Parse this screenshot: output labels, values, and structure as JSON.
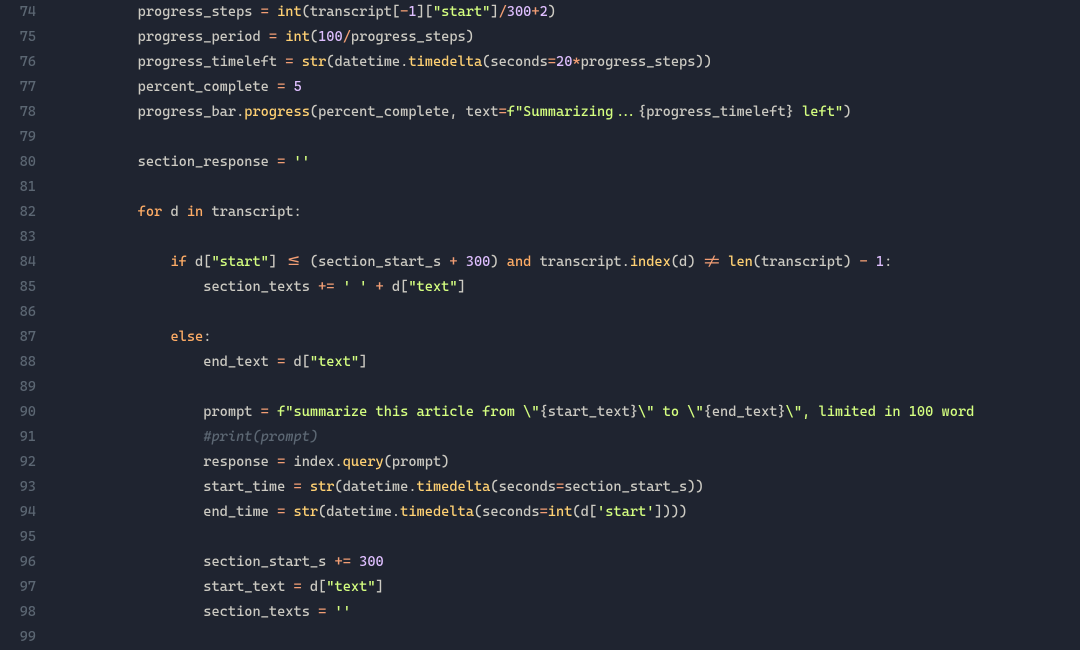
{
  "editor": {
    "first_line_number": 74,
    "lines": [
      {
        "n": 74,
        "tokens": [
          {
            "t": "indent",
            "v": "        "
          },
          {
            "t": "default",
            "v": "progress_steps "
          },
          {
            "t": "operator",
            "v": "="
          },
          {
            "t": "default",
            "v": " "
          },
          {
            "t": "builtin",
            "v": "int"
          },
          {
            "t": "punct",
            "v": "("
          },
          {
            "t": "default",
            "v": "transcript"
          },
          {
            "t": "punct",
            "v": "["
          },
          {
            "t": "operator",
            "v": "-"
          },
          {
            "t": "number",
            "v": "1"
          },
          {
            "t": "punct",
            "v": "]["
          },
          {
            "t": "string",
            "v": "\"start\""
          },
          {
            "t": "punct",
            "v": "]"
          },
          {
            "t": "operator",
            "v": "/"
          },
          {
            "t": "number",
            "v": "300"
          },
          {
            "t": "operator",
            "v": "+"
          },
          {
            "t": "number",
            "v": "2"
          },
          {
            "t": "punct",
            "v": ")"
          }
        ]
      },
      {
        "n": 75,
        "tokens": [
          {
            "t": "indent",
            "v": "        "
          },
          {
            "t": "default",
            "v": "progress_period "
          },
          {
            "t": "operator",
            "v": "="
          },
          {
            "t": "default",
            "v": " "
          },
          {
            "t": "builtin",
            "v": "int"
          },
          {
            "t": "punct",
            "v": "("
          },
          {
            "t": "number",
            "v": "100"
          },
          {
            "t": "operator",
            "v": "/"
          },
          {
            "t": "default",
            "v": "progress_steps"
          },
          {
            "t": "punct",
            "v": ")"
          }
        ]
      },
      {
        "n": 76,
        "tokens": [
          {
            "t": "indent",
            "v": "        "
          },
          {
            "t": "default",
            "v": "progress_timeleft "
          },
          {
            "t": "operator",
            "v": "="
          },
          {
            "t": "default",
            "v": " "
          },
          {
            "t": "builtin",
            "v": "str"
          },
          {
            "t": "punct",
            "v": "("
          },
          {
            "t": "default",
            "v": "datetime"
          },
          {
            "t": "punct",
            "v": "."
          },
          {
            "t": "function",
            "v": "timedelta"
          },
          {
            "t": "punct",
            "v": "("
          },
          {
            "t": "default",
            "v": "seconds"
          },
          {
            "t": "operator",
            "v": "="
          },
          {
            "t": "number",
            "v": "20"
          },
          {
            "t": "operator",
            "v": "*"
          },
          {
            "t": "default",
            "v": "progress_steps"
          },
          {
            "t": "punct",
            "v": "))"
          }
        ]
      },
      {
        "n": 77,
        "tokens": [
          {
            "t": "indent",
            "v": "        "
          },
          {
            "t": "default",
            "v": "percent_complete "
          },
          {
            "t": "operator",
            "v": "="
          },
          {
            "t": "default",
            "v": " "
          },
          {
            "t": "number",
            "v": "5"
          }
        ]
      },
      {
        "n": 78,
        "tokens": [
          {
            "t": "indent",
            "v": "        "
          },
          {
            "t": "default",
            "v": "progress_bar"
          },
          {
            "t": "punct",
            "v": "."
          },
          {
            "t": "function",
            "v": "progress"
          },
          {
            "t": "punct",
            "v": "("
          },
          {
            "t": "default",
            "v": "percent_complete"
          },
          {
            "t": "punct",
            "v": ", "
          },
          {
            "t": "default",
            "v": "text"
          },
          {
            "t": "operator",
            "v": "="
          },
          {
            "t": "fstring-prefix",
            "v": "f"
          },
          {
            "t": "string",
            "v": "\"Summarizing..."
          },
          {
            "t": "punct",
            "v": "{"
          },
          {
            "t": "default",
            "v": "progress_timeleft"
          },
          {
            "t": "punct",
            "v": "}"
          },
          {
            "t": "string",
            "v": " left\""
          },
          {
            "t": "punct",
            "v": ")"
          }
        ]
      },
      {
        "n": 79,
        "tokens": []
      },
      {
        "n": 80,
        "tokens": [
          {
            "t": "indent",
            "v": "        "
          },
          {
            "t": "default",
            "v": "section_response "
          },
          {
            "t": "operator",
            "v": "="
          },
          {
            "t": "default",
            "v": " "
          },
          {
            "t": "string",
            "v": "''"
          }
        ]
      },
      {
        "n": 81,
        "tokens": []
      },
      {
        "n": 82,
        "tokens": [
          {
            "t": "indent",
            "v": "        "
          },
          {
            "t": "keyword",
            "v": "for"
          },
          {
            "t": "default",
            "v": " d "
          },
          {
            "t": "keyword",
            "v": "in"
          },
          {
            "t": "default",
            "v": " transcript"
          },
          {
            "t": "punct",
            "v": ":"
          }
        ]
      },
      {
        "n": 83,
        "tokens": []
      },
      {
        "n": 84,
        "tokens": [
          {
            "t": "indent",
            "v": "            "
          },
          {
            "t": "keyword",
            "v": "if"
          },
          {
            "t": "default",
            "v": " d"
          },
          {
            "t": "punct",
            "v": "["
          },
          {
            "t": "string",
            "v": "\"start\""
          },
          {
            "t": "punct",
            "v": "] "
          },
          {
            "t": "operator",
            "v": "<="
          },
          {
            "t": "default",
            "v": " "
          },
          {
            "t": "punct",
            "v": "("
          },
          {
            "t": "default",
            "v": "section_start_s "
          },
          {
            "t": "operator",
            "v": "+"
          },
          {
            "t": "default",
            "v": " "
          },
          {
            "t": "number",
            "v": "300"
          },
          {
            "t": "punct",
            "v": ")"
          },
          {
            "t": "default",
            "v": " "
          },
          {
            "t": "keyword",
            "v": "and"
          },
          {
            "t": "default",
            "v": " transcript"
          },
          {
            "t": "punct",
            "v": "."
          },
          {
            "t": "function",
            "v": "index"
          },
          {
            "t": "punct",
            "v": "("
          },
          {
            "t": "default",
            "v": "d"
          },
          {
            "t": "punct",
            "v": ") "
          },
          {
            "t": "operator",
            "v": "!="
          },
          {
            "t": "default",
            "v": " "
          },
          {
            "t": "builtin",
            "v": "len"
          },
          {
            "t": "punct",
            "v": "("
          },
          {
            "t": "default",
            "v": "transcript"
          },
          {
            "t": "punct",
            "v": ") "
          },
          {
            "t": "operator",
            "v": "-"
          },
          {
            "t": "default",
            "v": " "
          },
          {
            "t": "number",
            "v": "1"
          },
          {
            "t": "punct",
            "v": ":"
          }
        ]
      },
      {
        "n": 85,
        "tokens": [
          {
            "t": "indent",
            "v": "                "
          },
          {
            "t": "default",
            "v": "section_texts "
          },
          {
            "t": "operator",
            "v": "+="
          },
          {
            "t": "default",
            "v": " "
          },
          {
            "t": "string",
            "v": "' '"
          },
          {
            "t": "default",
            "v": " "
          },
          {
            "t": "operator",
            "v": "+"
          },
          {
            "t": "default",
            "v": " d"
          },
          {
            "t": "punct",
            "v": "["
          },
          {
            "t": "string",
            "v": "\"text\""
          },
          {
            "t": "punct",
            "v": "]"
          }
        ]
      },
      {
        "n": 86,
        "tokens": []
      },
      {
        "n": 87,
        "tokens": [
          {
            "t": "indent",
            "v": "            "
          },
          {
            "t": "keyword",
            "v": "else"
          },
          {
            "t": "punct",
            "v": ":"
          }
        ]
      },
      {
        "n": 88,
        "tokens": [
          {
            "t": "indent",
            "v": "                "
          },
          {
            "t": "default",
            "v": "end_text "
          },
          {
            "t": "operator",
            "v": "="
          },
          {
            "t": "default",
            "v": " d"
          },
          {
            "t": "punct",
            "v": "["
          },
          {
            "t": "string",
            "v": "\"text\""
          },
          {
            "t": "punct",
            "v": "]"
          }
        ]
      },
      {
        "n": 89,
        "tokens": []
      },
      {
        "n": 90,
        "tokens": [
          {
            "t": "indent",
            "v": "                "
          },
          {
            "t": "default",
            "v": "prompt "
          },
          {
            "t": "operator",
            "v": "="
          },
          {
            "t": "default",
            "v": " "
          },
          {
            "t": "fstring-prefix",
            "v": "f"
          },
          {
            "t": "string",
            "v": "\"summarize this article from \\\""
          },
          {
            "t": "punct",
            "v": "{"
          },
          {
            "t": "default",
            "v": "start_text"
          },
          {
            "t": "punct",
            "v": "}"
          },
          {
            "t": "string",
            "v": "\\\" to \\\""
          },
          {
            "t": "punct",
            "v": "{"
          },
          {
            "t": "default",
            "v": "end_text"
          },
          {
            "t": "punct",
            "v": "}"
          },
          {
            "t": "string",
            "v": "\\\", limited in 100 word"
          }
        ]
      },
      {
        "n": 91,
        "tokens": [
          {
            "t": "indent",
            "v": "                "
          },
          {
            "t": "comment",
            "v": "#print(prompt)"
          }
        ]
      },
      {
        "n": 92,
        "tokens": [
          {
            "t": "indent",
            "v": "                "
          },
          {
            "t": "default",
            "v": "response "
          },
          {
            "t": "operator",
            "v": "="
          },
          {
            "t": "default",
            "v": " index"
          },
          {
            "t": "punct",
            "v": "."
          },
          {
            "t": "function",
            "v": "query"
          },
          {
            "t": "punct",
            "v": "("
          },
          {
            "t": "default",
            "v": "prompt"
          },
          {
            "t": "punct",
            "v": ")"
          }
        ]
      },
      {
        "n": 93,
        "tokens": [
          {
            "t": "indent",
            "v": "                "
          },
          {
            "t": "default",
            "v": "start_time "
          },
          {
            "t": "operator",
            "v": "="
          },
          {
            "t": "default",
            "v": " "
          },
          {
            "t": "builtin",
            "v": "str"
          },
          {
            "t": "punct",
            "v": "("
          },
          {
            "t": "default",
            "v": "datetime"
          },
          {
            "t": "punct",
            "v": "."
          },
          {
            "t": "function",
            "v": "timedelta"
          },
          {
            "t": "punct",
            "v": "("
          },
          {
            "t": "default",
            "v": "seconds"
          },
          {
            "t": "operator",
            "v": "="
          },
          {
            "t": "default",
            "v": "section_start_s"
          },
          {
            "t": "punct",
            "v": "))"
          }
        ]
      },
      {
        "n": 94,
        "tokens": [
          {
            "t": "indent",
            "v": "                "
          },
          {
            "t": "default",
            "v": "end_time "
          },
          {
            "t": "operator",
            "v": "="
          },
          {
            "t": "default",
            "v": " "
          },
          {
            "t": "builtin",
            "v": "str"
          },
          {
            "t": "punct",
            "v": "("
          },
          {
            "t": "default",
            "v": "datetime"
          },
          {
            "t": "punct",
            "v": "."
          },
          {
            "t": "function",
            "v": "timedelta"
          },
          {
            "t": "punct",
            "v": "("
          },
          {
            "t": "default",
            "v": "seconds"
          },
          {
            "t": "operator",
            "v": "="
          },
          {
            "t": "builtin",
            "v": "int"
          },
          {
            "t": "punct",
            "v": "("
          },
          {
            "t": "default",
            "v": "d"
          },
          {
            "t": "punct",
            "v": "["
          },
          {
            "t": "string",
            "v": "'start'"
          },
          {
            "t": "punct",
            "v": "])))"
          }
        ]
      },
      {
        "n": 95,
        "tokens": []
      },
      {
        "n": 96,
        "tokens": [
          {
            "t": "indent",
            "v": "                "
          },
          {
            "t": "default",
            "v": "section_start_s "
          },
          {
            "t": "operator",
            "v": "+="
          },
          {
            "t": "default",
            "v": " "
          },
          {
            "t": "number",
            "v": "300"
          }
        ]
      },
      {
        "n": 97,
        "tokens": [
          {
            "t": "indent",
            "v": "                "
          },
          {
            "t": "default",
            "v": "start_text "
          },
          {
            "t": "operator",
            "v": "="
          },
          {
            "t": "default",
            "v": " d"
          },
          {
            "t": "punct",
            "v": "["
          },
          {
            "t": "string",
            "v": "\"text\""
          },
          {
            "t": "punct",
            "v": "]"
          }
        ]
      },
      {
        "n": 98,
        "tokens": [
          {
            "t": "indent",
            "v": "                "
          },
          {
            "t": "default",
            "v": "section_texts "
          },
          {
            "t": "operator",
            "v": "="
          },
          {
            "t": "default",
            "v": " "
          },
          {
            "t": "string",
            "v": "''"
          }
        ]
      },
      {
        "n": 99,
        "tokens": []
      }
    ]
  }
}
